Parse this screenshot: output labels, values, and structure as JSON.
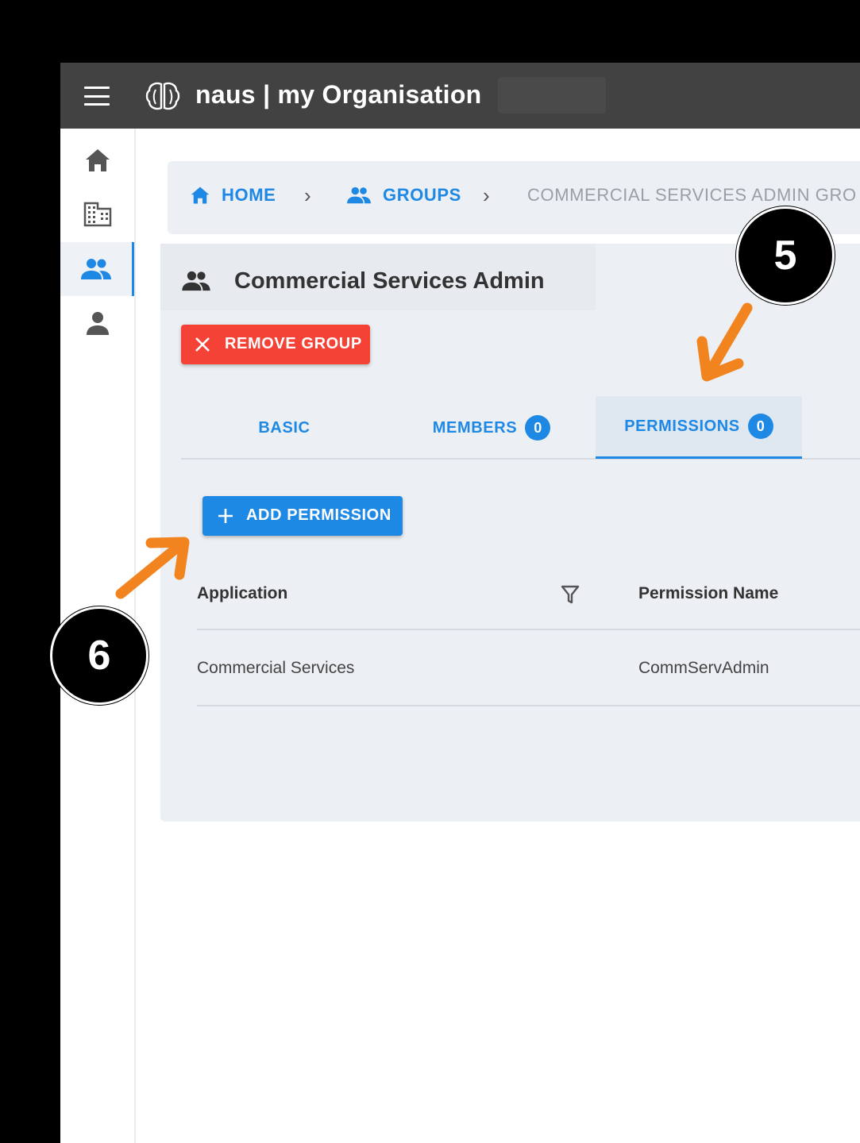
{
  "app": {
    "title": "naus | my Organisation"
  },
  "breadcrumb": {
    "home": "HOME",
    "groups": "GROUPS",
    "current": "COMMERCIAL SERVICES ADMIN GRO"
  },
  "group": {
    "title": "Commercial Services Admin",
    "remove_label": "REMOVE GROUP"
  },
  "tabs": [
    {
      "label": "BASIC",
      "badge": null
    },
    {
      "label": "MEMBERS",
      "badge": "0"
    },
    {
      "label": "PERMISSIONS",
      "badge": "0",
      "active": true
    }
  ],
  "permissions": {
    "add_label": "ADD PERMISSION",
    "columns": [
      "Application",
      "Permission Name"
    ],
    "rows": [
      {
        "application": "Commercial Services",
        "permission_name": "CommServAdmin"
      }
    ]
  },
  "annotations": {
    "step5": "5",
    "step6": "6"
  },
  "colors": {
    "primary": "#1e88e5",
    "danger": "#f44336",
    "appbar": "#424242",
    "annotation_arrow": "#f2841f"
  }
}
